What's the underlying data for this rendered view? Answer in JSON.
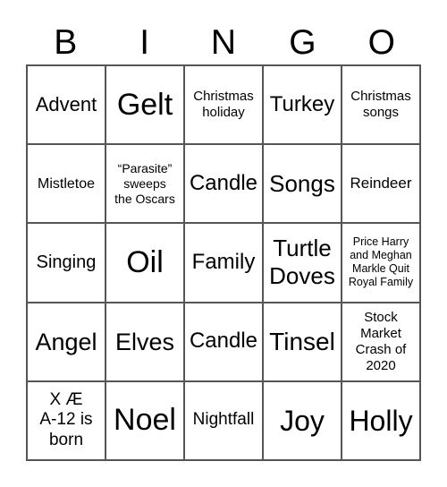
{
  "header": [
    "B",
    "I",
    "N",
    "G",
    "O"
  ],
  "cells": [
    "Advent",
    "Gelt",
    "Christmas holiday",
    "Turkey",
    "Christmas songs",
    "Mistletoe",
    "“Parasite” sweeps the Oscars",
    "Candle",
    "Songs",
    "Reindeer",
    "Singing",
    "Oil",
    "Family",
    "Turtle Doves",
    "Price Harry and Meghan Markle Quit Royal Family",
    "Angel",
    "Elves",
    "Candle",
    "Tinsel",
    "Stock Market Crash of 2020",
    "X Æ A-12 is born",
    "Noel",
    "Nightfall",
    "Joy",
    "Holly"
  ]
}
